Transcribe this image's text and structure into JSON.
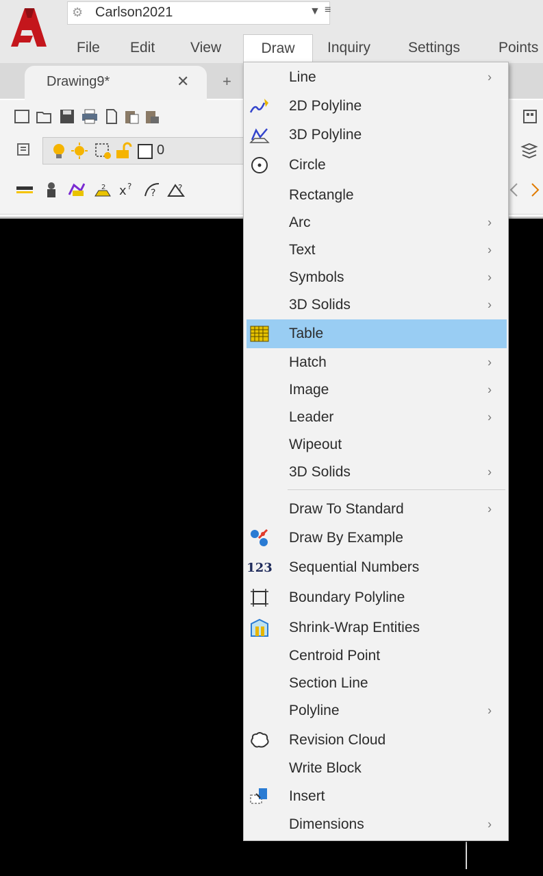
{
  "app": {
    "workspace_name": "Carlson2021"
  },
  "menubar": [
    "File",
    "Edit",
    "View",
    "Draw",
    "Inquiry",
    "Settings",
    "Points"
  ],
  "tabs": {
    "document": "Drawing9*",
    "close": "✕",
    "add": "+"
  },
  "layer_toolbar": {
    "current_layer": "0"
  },
  "draw_menu": {
    "items": [
      {
        "label": "Line",
        "submenu": true,
        "icon": ""
      },
      {
        "label": "2D Polyline",
        "submenu": false,
        "icon": "polyline-2d-icon"
      },
      {
        "label": "3D Polyline",
        "submenu": false,
        "icon": "polyline-3d-icon"
      },
      {
        "label": "Circle",
        "submenu": false,
        "icon": "circle-icon"
      },
      {
        "label": "Rectangle",
        "submenu": false,
        "icon": ""
      },
      {
        "label": "Arc",
        "submenu": true,
        "icon": ""
      },
      {
        "label": "Text",
        "submenu": true,
        "icon": ""
      },
      {
        "label": "Symbols",
        "submenu": true,
        "icon": ""
      },
      {
        "label": "3D Solids",
        "submenu": true,
        "icon": ""
      },
      {
        "label": "Table",
        "submenu": false,
        "icon": "table-icon",
        "highlighted": true
      },
      {
        "label": "Hatch",
        "submenu": true,
        "icon": ""
      },
      {
        "label": "Image",
        "submenu": true,
        "icon": ""
      },
      {
        "label": "Leader",
        "submenu": true,
        "icon": ""
      },
      {
        "label": "Wipeout",
        "submenu": false,
        "icon": ""
      },
      {
        "label": "3D Solids",
        "submenu": true,
        "icon": ""
      },
      {
        "label": "Draw To Standard",
        "submenu": true,
        "icon": ""
      },
      {
        "label": "Draw By Example",
        "submenu": false,
        "icon": "draw-by-example-icon"
      },
      {
        "label": "Sequential Numbers",
        "submenu": false,
        "icon": "sequential-numbers-icon",
        "icon_text": "123"
      },
      {
        "label": "Boundary Polyline",
        "submenu": false,
        "icon": "boundary-polyline-icon"
      },
      {
        "label": "Shrink-Wrap Entities",
        "submenu": false,
        "icon": "shrink-wrap-icon"
      },
      {
        "label": "Centroid Point",
        "submenu": false,
        "icon": ""
      },
      {
        "label": "Section Line",
        "submenu": false,
        "icon": ""
      },
      {
        "label": "Polyline",
        "submenu": true,
        "icon": ""
      },
      {
        "label": "Revision Cloud",
        "submenu": false,
        "icon": "revision-cloud-icon"
      },
      {
        "label": "Write Block",
        "submenu": false,
        "icon": ""
      },
      {
        "label": "Insert",
        "submenu": false,
        "icon": "insert-block-icon"
      },
      {
        "label": "Dimensions",
        "submenu": true,
        "icon": ""
      }
    ]
  },
  "colors": {
    "highlight": "#99cdf3",
    "canvas": "#000000",
    "logo_red": "#c4161c"
  }
}
